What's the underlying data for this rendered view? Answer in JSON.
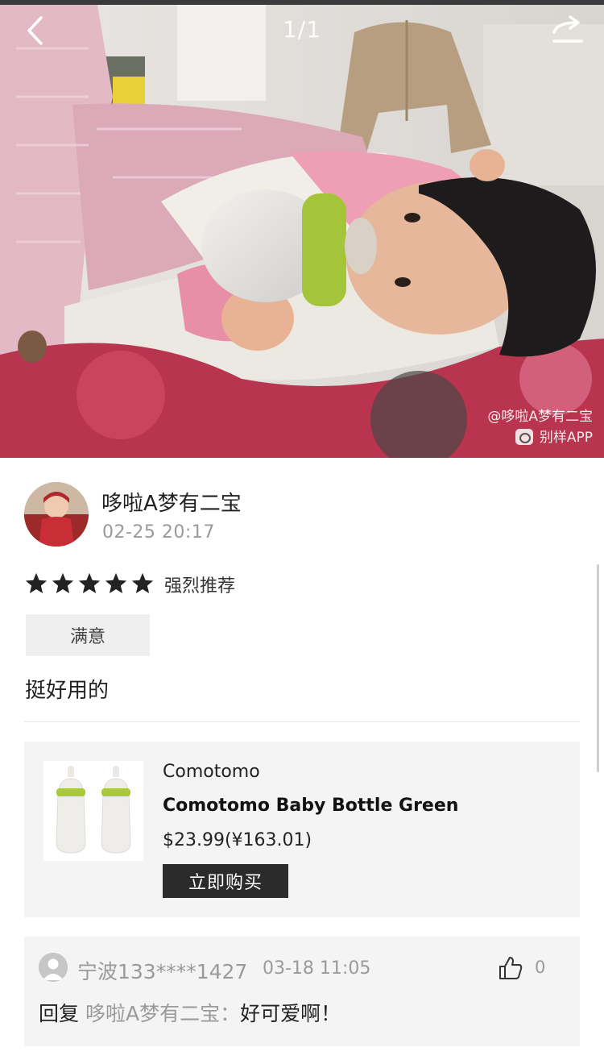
{
  "gallery": {
    "counter": "1/1",
    "back_icon": "chevron-left-icon",
    "share_icon": "share-icon",
    "watermark_line1": "@哆啦A梦有二宝",
    "watermark_line2": "别样APP"
  },
  "review": {
    "user_name": "哆啦A梦有二宝",
    "time": "02-25 20:17",
    "rating": 5,
    "rating_max": 5,
    "rating_label": "强烈推荐",
    "tag": "满意",
    "text": "挺好用的"
  },
  "product": {
    "brand": "Comotomo",
    "name": "Comotomo Baby Bottle Green",
    "price": "$23.99(¥163.01)",
    "buy_label": "立即购买",
    "accent_color": "#a9c93a"
  },
  "comment": {
    "user": "宁波133****1427",
    "time": "03-18 11:05",
    "like_count": "0",
    "reply_prefix": "回复",
    "reply_target": "哆啦A梦有二宝：",
    "text": "好可爱啊！"
  }
}
